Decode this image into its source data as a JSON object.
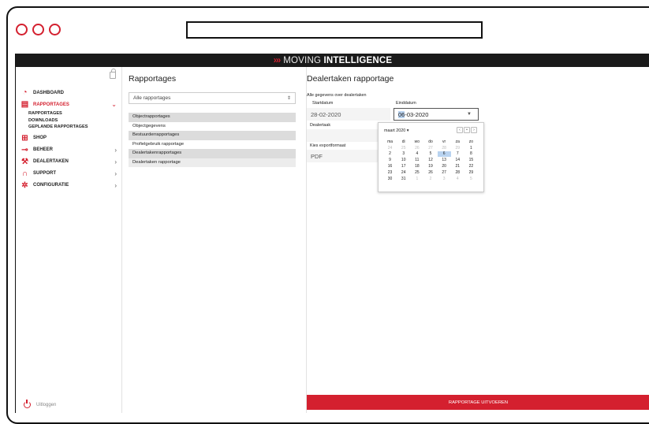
{
  "brand": {
    "chevrons": "›››",
    "thin": "MOVING",
    "bold": "INTELLIGENCE"
  },
  "sidebar": {
    "items": [
      {
        "label": "DASHBOARD",
        "icon": "gauge-icon",
        "arrow": ""
      },
      {
        "label": "RAPPORTAGES",
        "icon": "document-icon",
        "arrow": "⌄"
      },
      {
        "label": "SHOP",
        "icon": "cart-icon",
        "arrow": ""
      },
      {
        "label": "BEHEER",
        "icon": "key-icon",
        "arrow": "›"
      },
      {
        "label": "DEALERTAKEN",
        "icon": "wrench-icon",
        "arrow": "›"
      },
      {
        "label": "SUPPORT",
        "icon": "headset-icon",
        "arrow": "›"
      },
      {
        "label": "CONFIGURATIE",
        "icon": "gear-icon",
        "arrow": "›"
      }
    ],
    "subitems": [
      "RAPPORTAGES",
      "DOWNLOADS",
      "GEPLANDE RAPPORTAGES"
    ],
    "logout": "Uitloggen",
    "accent": "#d4202f"
  },
  "reports": {
    "title": "Rapportages",
    "filter": {
      "value": "Alle rapportages",
      "caret": "⇕"
    },
    "list": [
      {
        "label": "Objectrapportages",
        "kind": "group"
      },
      {
        "label": "Objectgegevens",
        "kind": "item"
      },
      {
        "label": "Bestuurderrapportages",
        "kind": "group"
      },
      {
        "label": "Profielgebruik rapportage",
        "kind": "item"
      },
      {
        "label": "Dealertakenrapportages",
        "kind": "group"
      },
      {
        "label": "Dealertaken rapportage",
        "kind": "selected"
      }
    ]
  },
  "detail": {
    "title": "Dealertaken rapportage",
    "description": "Alle gegevens over dealertaken",
    "start_label": "Startdatum",
    "start_value": "28-02-2020",
    "end_label": "Einddatum",
    "end_value_hl": "06",
    "end_value_rest": "-03-2020",
    "dealer_label": "Dealertaak",
    "export_label": "Kies exportformaat",
    "export_value": "PDF",
    "run_button": "RAPPORTAGE UITVOEREN"
  },
  "calendar": {
    "month": "maart 2020 ▾",
    "nav": [
      "‹",
      "•",
      "›"
    ],
    "weekdays": [
      "ma",
      "di",
      "wo",
      "do",
      "vr",
      "za",
      "zo"
    ],
    "days": [
      [
        "24",
        "o"
      ],
      [
        "25",
        "o"
      ],
      [
        "26",
        "o"
      ],
      [
        "27",
        "o"
      ],
      [
        "28",
        "o"
      ],
      [
        "29",
        "o"
      ],
      [
        "1",
        ""
      ],
      [
        "2",
        ""
      ],
      [
        "3",
        ""
      ],
      [
        "4",
        ""
      ],
      [
        "5",
        ""
      ],
      [
        "6",
        "t"
      ],
      [
        "7",
        ""
      ],
      [
        "8",
        ""
      ],
      [
        "9",
        ""
      ],
      [
        "10",
        ""
      ],
      [
        "11",
        ""
      ],
      [
        "12",
        ""
      ],
      [
        "13",
        ""
      ],
      [
        "14",
        ""
      ],
      [
        "15",
        ""
      ],
      [
        "16",
        ""
      ],
      [
        "17",
        ""
      ],
      [
        "18",
        ""
      ],
      [
        "19",
        ""
      ],
      [
        "20",
        ""
      ],
      [
        "21",
        ""
      ],
      [
        "22",
        ""
      ],
      [
        "23",
        ""
      ],
      [
        "24",
        ""
      ],
      [
        "25",
        ""
      ],
      [
        "26",
        ""
      ],
      [
        "27",
        ""
      ],
      [
        "28",
        ""
      ],
      [
        "29",
        ""
      ],
      [
        "30",
        ""
      ],
      [
        "31",
        ""
      ],
      [
        "1",
        "o"
      ],
      [
        "2",
        "o"
      ],
      [
        "3",
        "o"
      ],
      [
        "4",
        "o"
      ],
      [
        "5",
        "o"
      ]
    ]
  }
}
